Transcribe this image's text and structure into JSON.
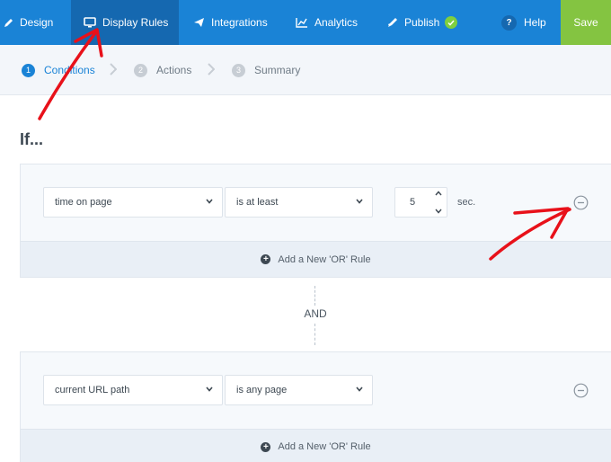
{
  "nav": {
    "items": [
      {
        "label": "Design",
        "icon": "pencil-icon"
      },
      {
        "label": "Display Rules",
        "icon": "monitor-icon",
        "active": true
      },
      {
        "label": "Integrations",
        "icon": "paper-plane-icon"
      },
      {
        "label": "Analytics",
        "icon": "chart-icon"
      },
      {
        "label": "Publish",
        "icon": "rocket-icon"
      }
    ],
    "help_label": "Help",
    "help_glyph": "?",
    "save_label": "Save"
  },
  "steps": [
    {
      "number": "1",
      "label": "Conditions",
      "active": true
    },
    {
      "number": "2",
      "label": "Actions"
    },
    {
      "number": "3",
      "label": "Summary"
    }
  ],
  "if_heading": "If...",
  "groups": [
    {
      "field": "time on page",
      "operator": "is at least",
      "value": "5",
      "unit": "sec.",
      "add_or_label": "Add a New 'OR' Rule"
    },
    {
      "field": "current URL path",
      "operator": "is any page",
      "add_or_label": "Add a New 'OR' Rule"
    }
  ],
  "and_label": "AND",
  "colors": {
    "nav_bg": "#1a83d6",
    "nav_active_bg": "#1568b0",
    "save_bg": "#84c441",
    "annotation_red": "#e8111a"
  }
}
